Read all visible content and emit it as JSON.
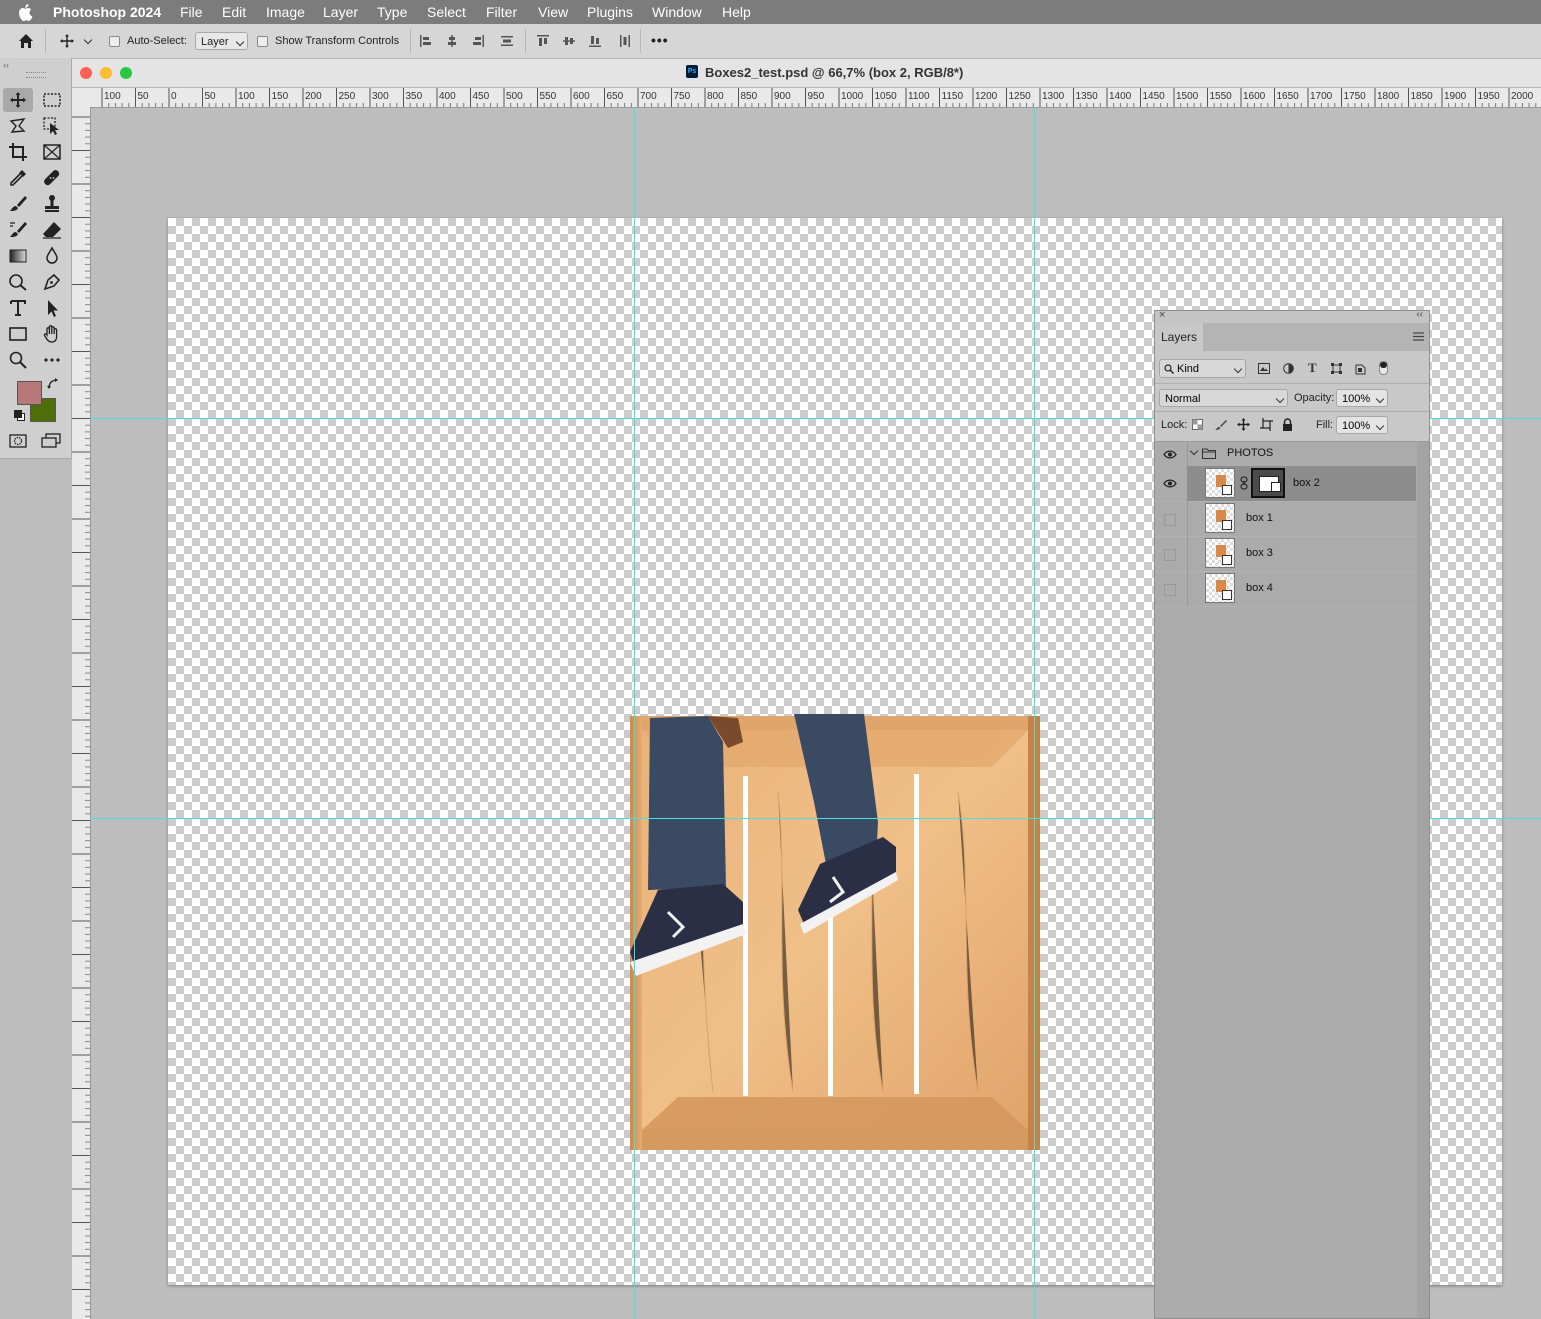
{
  "menubar": {
    "app_name": "Photoshop 2024",
    "items": [
      "File",
      "Edit",
      "Image",
      "Layer",
      "Type",
      "Select",
      "Filter",
      "View",
      "Plugins",
      "Window",
      "Help"
    ]
  },
  "options_bar": {
    "auto_select_label": "Auto-Select:",
    "auto_select_value": "Layer",
    "show_transform_label": "Show Transform Controls",
    "auto_select_checked": false,
    "show_transform_checked": false,
    "more_label": "•••"
  },
  "toolbar": {
    "foreground_color": "#b87878",
    "background_color": "#4e6e0a",
    "tools": [
      "move-tool",
      "marquee-tool",
      "lasso-tool",
      "object-selection-tool",
      "crop-tool",
      "frame-tool",
      "eyedropper-tool",
      "healing-brush-tool",
      "brush-tool",
      "clone-stamp-tool",
      "history-brush-tool",
      "eraser-tool",
      "gradient-tool",
      "blur-tool",
      "dodge-tool",
      "pen-tool",
      "type-tool",
      "path-selection-tool",
      "rectangle-tool",
      "hand-tool",
      "zoom-tool",
      "more-tools"
    ]
  },
  "document": {
    "title": "Boxes2_test.psd @ 66,7% (box 2, RGB/8*)",
    "ps_badge": "Ps",
    "ruler_labels": [
      "100",
      "50",
      "0",
      "50",
      "100",
      "150",
      "200",
      "250",
      "300",
      "350",
      "400",
      "450",
      "500",
      "550",
      "600",
      "650",
      "700",
      "750",
      "800",
      "850",
      "900",
      "950",
      "1000",
      "1050",
      "1100",
      "1150",
      "1200",
      "1250",
      "1300",
      "1350",
      "1400",
      "1450",
      "1500",
      "1550",
      "1600",
      "1650",
      "1700",
      "1750",
      "1800",
      "1850",
      "1900",
      "1950",
      "2000"
    ],
    "guide_color": "#45e0e0"
  },
  "layers_panel": {
    "tab_label": "Layers",
    "filter_kind": "Kind",
    "blend_mode": "Normal",
    "opacity_label": "Opacity:",
    "opacity_value": "100%",
    "lock_label": "Lock:",
    "fill_label": "Fill:",
    "fill_value": "100%",
    "group_name": "PHOTOS",
    "layers": [
      {
        "name": "box 2",
        "visible": true,
        "selected": true
      },
      {
        "name": "box 1",
        "visible": false,
        "selected": false
      },
      {
        "name": "box 3",
        "visible": false,
        "selected": false
      },
      {
        "name": "box 4",
        "visible": false,
        "selected": false
      }
    ]
  }
}
